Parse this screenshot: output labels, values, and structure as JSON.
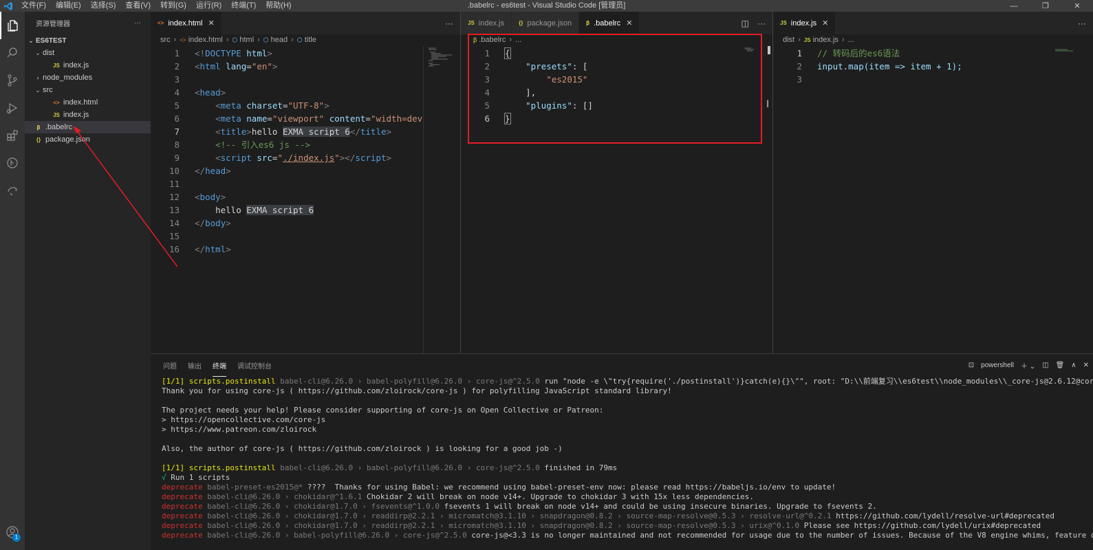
{
  "window": {
    "title": ".babelrc - es6test - Visual Studio Code [管理员]",
    "menu": [
      "文件(F)",
      "编辑(E)",
      "选择(S)",
      "查看(V)",
      "转到(G)",
      "运行(R)",
      "终端(T)",
      "帮助(H)"
    ]
  },
  "activitybar": {
    "icons": [
      "explorer-icon",
      "search-icon",
      "source-control-icon",
      "run-debug-icon",
      "extensions-icon",
      "git-graph-icon",
      "remote-icon"
    ],
    "account_badge": "1"
  },
  "sidebar": {
    "title": "资源管理器",
    "more": "···",
    "root": "ES6TEST",
    "items": [
      {
        "label": "dist",
        "type": "folder",
        "depth": 1
      },
      {
        "label": "index.js",
        "type": "js",
        "depth": 2
      },
      {
        "label": "node_modules",
        "type": "folder-collapsed",
        "depth": 1
      },
      {
        "label": "src",
        "type": "folder",
        "depth": 1
      },
      {
        "label": "index.html",
        "type": "html",
        "depth": 2
      },
      {
        "label": "index.js",
        "type": "js",
        "depth": 2
      },
      {
        "label": ".babelrc",
        "type": "babel",
        "depth": 1
      },
      {
        "label": "package.json",
        "type": "json",
        "depth": 1
      }
    ]
  },
  "group1": {
    "tab": "index.html",
    "breadcrumb": [
      "src",
      "index.html",
      "html",
      "head",
      "title"
    ],
    "lines": [
      "1",
      "2",
      "3",
      "4",
      "5",
      "6",
      "7",
      "8",
      "9",
      "10",
      "11",
      "12",
      "13",
      "14",
      "15",
      "16"
    ]
  },
  "group2": {
    "tabs": [
      "index.js",
      "package.json",
      ".babelrc"
    ],
    "breadcrumb": [
      ".babelrc",
      "..."
    ],
    "lines": [
      "1",
      "2",
      "3",
      "4",
      "5",
      "6"
    ]
  },
  "group3": {
    "tab": "index.js",
    "breadcrumb": [
      "dist",
      "index.js",
      "..."
    ],
    "lines": [
      "1",
      "2",
      "3"
    ],
    "comment": "// 转码后的es6语法",
    "code_line2": "input.map(item => item + 1);"
  },
  "panel": {
    "tabs": [
      "问题",
      "输出",
      "终端",
      "调试控制台"
    ],
    "active_tab": "终端",
    "shell": "powershell"
  }
}
